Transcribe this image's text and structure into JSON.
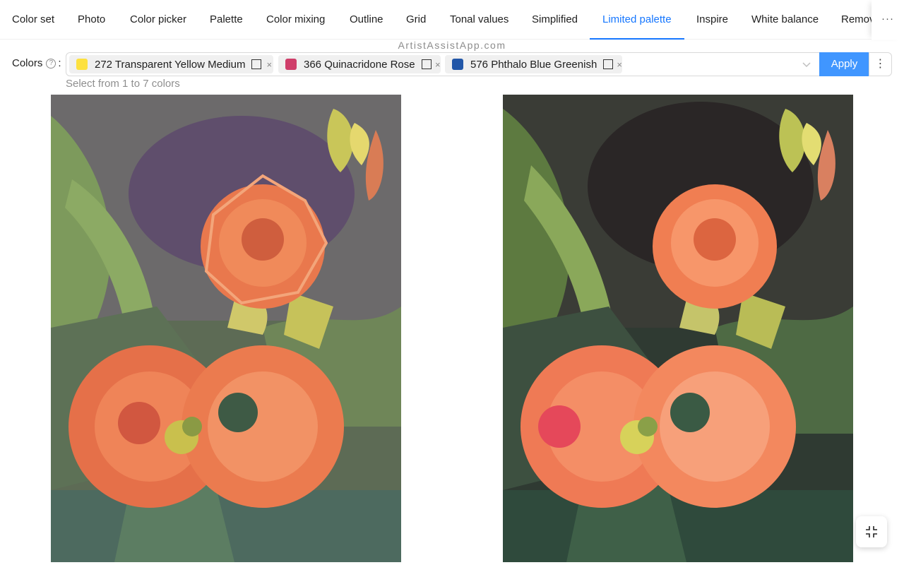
{
  "tabs": {
    "items": [
      {
        "label": "Color set"
      },
      {
        "label": "Photo"
      },
      {
        "label": "Color picker"
      },
      {
        "label": "Palette"
      },
      {
        "label": "Color mixing"
      },
      {
        "label": "Outline"
      },
      {
        "label": "Grid"
      },
      {
        "label": "Tonal values"
      },
      {
        "label": "Simplified"
      },
      {
        "label": "Limited palette"
      },
      {
        "label": "Inspire"
      },
      {
        "label": "White balance"
      },
      {
        "label": "Remov"
      }
    ],
    "active_index": 9,
    "more_label": "···"
  },
  "watermark": "ArtistAssistApp.com",
  "colors_field": {
    "label": "Colors",
    "help_glyph": "?",
    "colon": ":",
    "selected": [
      {
        "label": "272 Transparent Yellow Medium",
        "swatch": "#fde13f"
      },
      {
        "label": "366 Quinacridone Rose",
        "swatch": "#cf3e6a"
      },
      {
        "label": "576 Phthalo Blue Greenish",
        "swatch": "#2257a8"
      }
    ],
    "remove_glyph": "×",
    "hint": "Select from 1 to 7 colors"
  },
  "apply_label": "Apply",
  "more_actions_label": "⋮",
  "colors": {
    "accent": "#1677ff",
    "apply_bg": "#4096ff"
  }
}
